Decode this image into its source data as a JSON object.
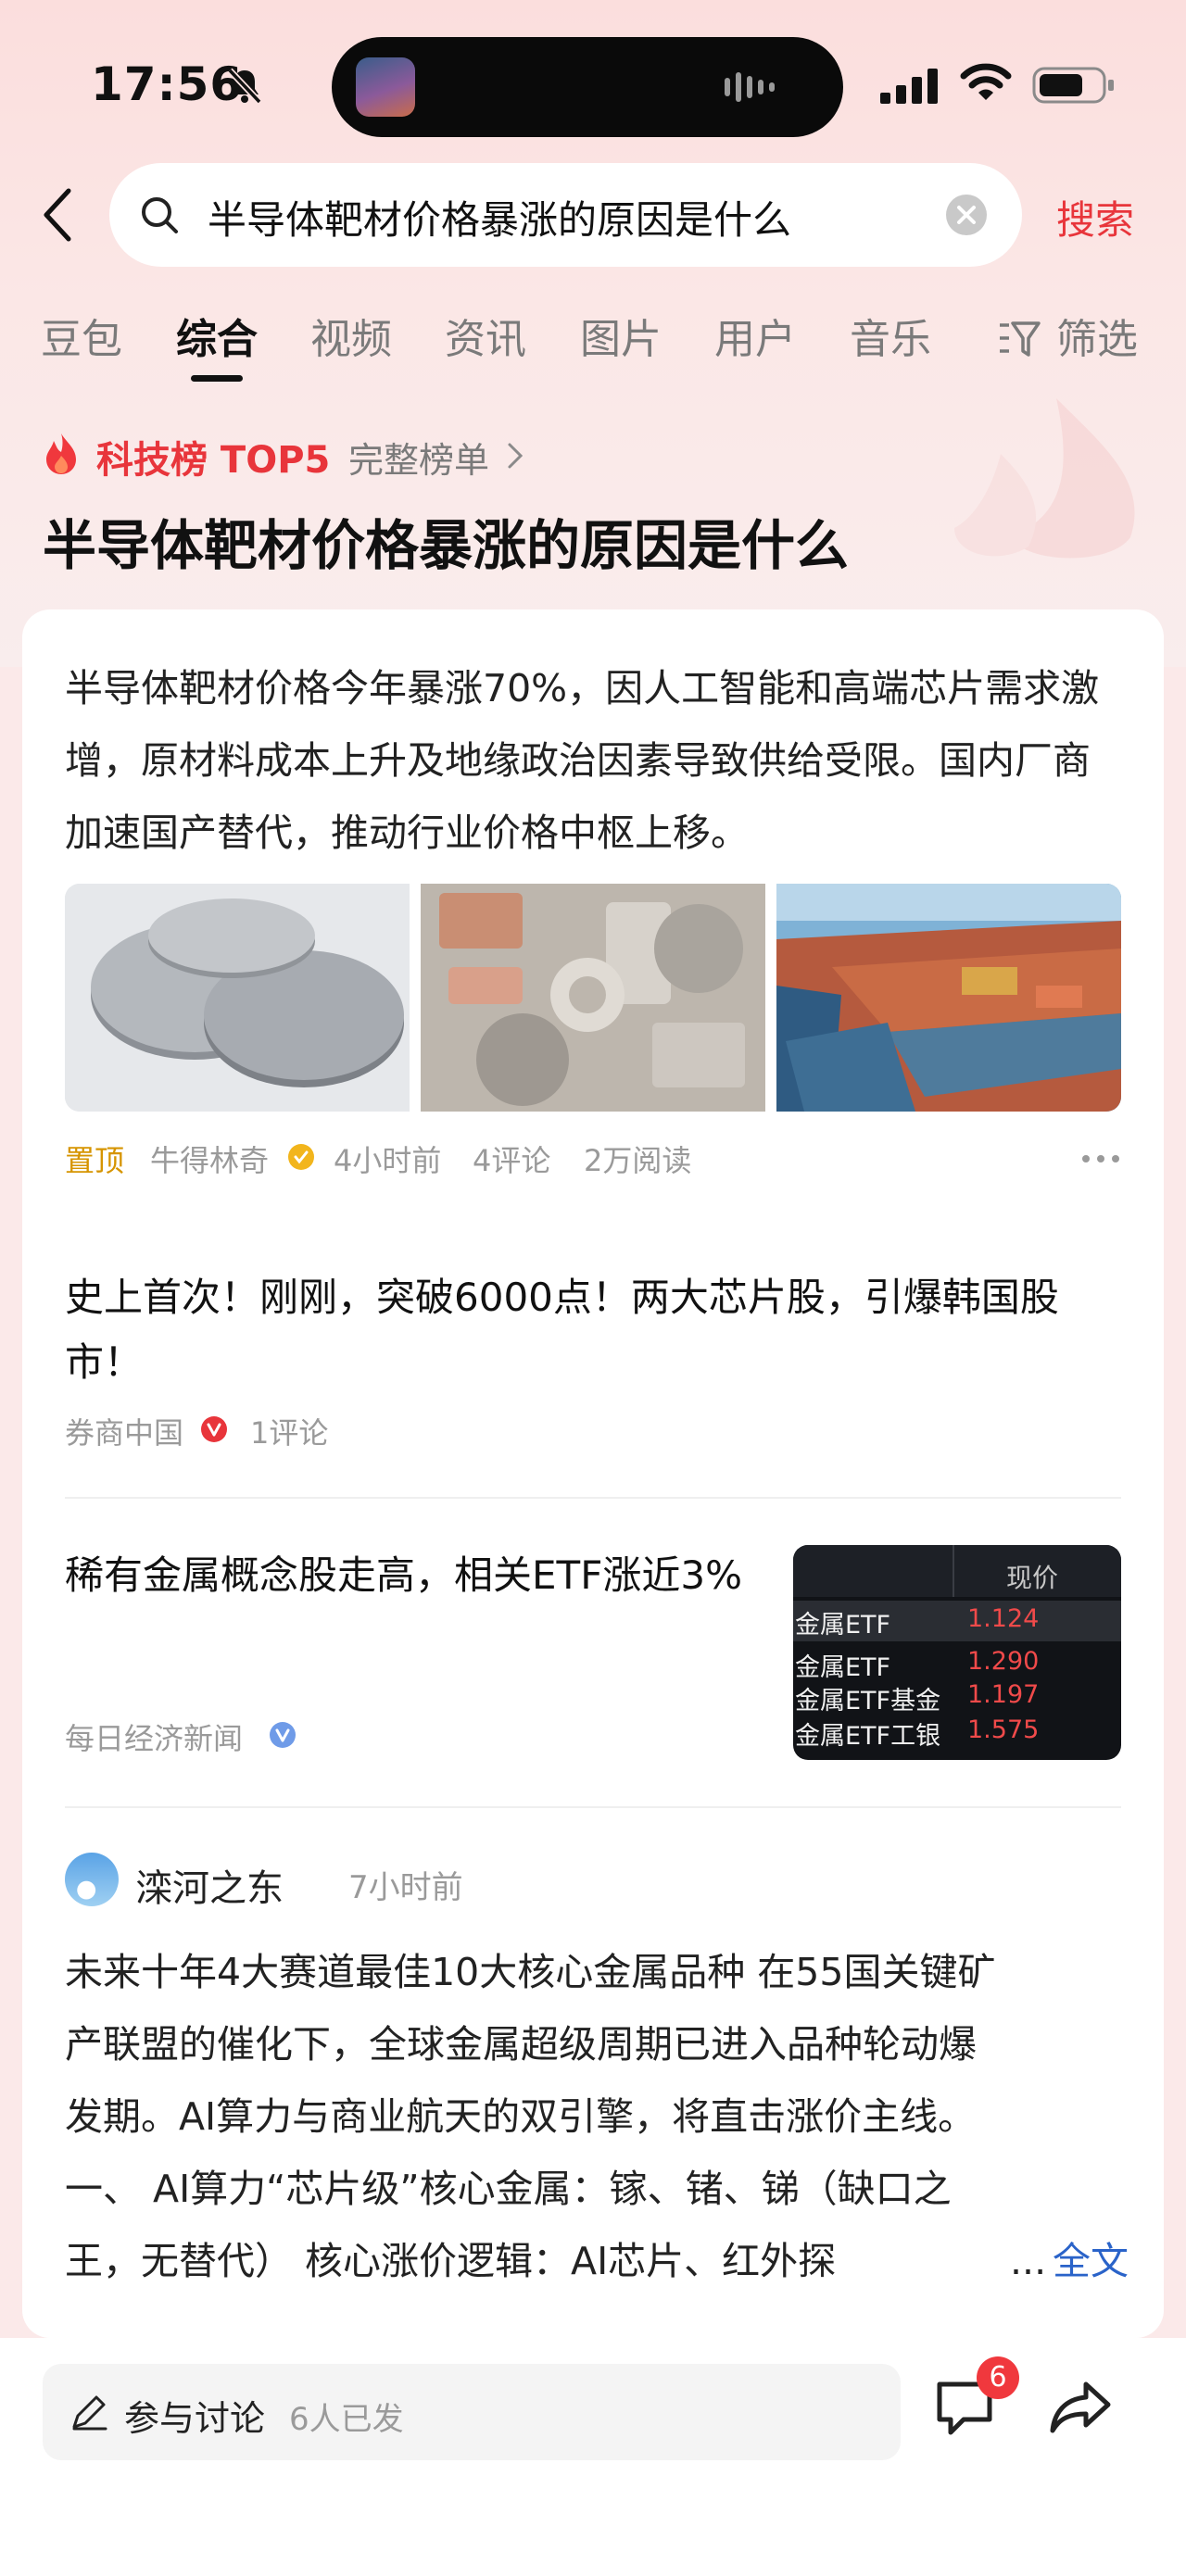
{
  "status_bar": {
    "time": "17:56",
    "icons": [
      "bell-slash-icon",
      "cellular-signal-icon",
      "wifi-icon",
      "battery-icon"
    ]
  },
  "search": {
    "query": "半导体靶材价格暴涨的原因是什么",
    "button_label": "搜索"
  },
  "tabs": [
    {
      "label": "豆包",
      "active": false
    },
    {
      "label": "综合",
      "active": true
    },
    {
      "label": "视频",
      "active": false
    },
    {
      "label": "资讯",
      "active": false
    },
    {
      "label": "图片",
      "active": false
    },
    {
      "label": "用户",
      "active": false
    },
    {
      "label": "音乐",
      "active": false
    },
    {
      "label": "筛选",
      "active": false
    }
  ],
  "hot": {
    "label": "科技榜 TOP5",
    "link": "完整榜单"
  },
  "page_title": "半导体靶材价格暴涨的原因是什么",
  "summary": {
    "text": "半导体靶材价格今年暴涨70%，因人工智能和高端芯片需求激增，原材料成本上升及地缘政治因素导致供给受限。国内厂商加速国产替代，推动行业价格中枢上移。",
    "pin": "置顶",
    "source": "牛得林奇",
    "time": "4小时前",
    "comments": "4评论",
    "reads": "2万阅读"
  },
  "news": [
    {
      "title": "史上首次！刚刚，突破6000点！两大芯片股，引爆韩国股市！",
      "source": "券商中国",
      "comments": "1评论"
    },
    {
      "title": "稀有金属概念股走高，相关ETF涨近3%",
      "source": "每日经济新闻",
      "thumb": {
        "header": "现价",
        "rows": [
          {
            "name": "金属ETF",
            "value": "1.124"
          },
          {
            "name": "金属ETF",
            "value": "1.290"
          },
          {
            "name": "金属ETF基金",
            "value": "1.197"
          },
          {
            "name": "金属ETF工银",
            "value": "1.575"
          }
        ]
      }
    }
  ],
  "post": {
    "author": "滦河之东",
    "time": "7小时前",
    "lines": [
      "未来十年4大赛道最佳10大核心金属品种 在55国关键矿",
      "产联盟的催化下，全球金属超级周期已进入品种轮动爆",
      "发期。AI算力与商业航天的双引擎，将直击涨价主线。",
      "一、 AI算力“芯片级”核心金属：镓、锗、锑（缺口之"
    ],
    "last_line": "王，无替代） 核心涨价逻辑：AI芯片、红外探",
    "ellipsis": "...",
    "more_label": "全文"
  },
  "bottom": {
    "discuss_label": "参与讨论",
    "discuss_count": "6人已发",
    "comment_badge": "6"
  },
  "colors": {
    "accent": "#e8353b",
    "link": "#2a63c9",
    "pin": "#d69400"
  }
}
